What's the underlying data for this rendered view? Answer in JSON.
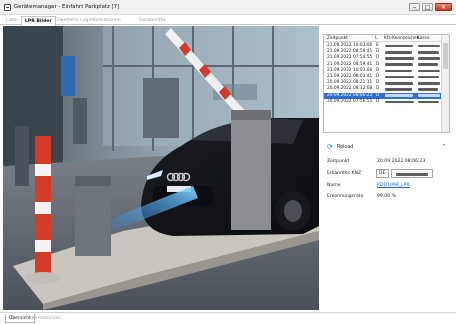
{
  "window": {
    "title": "Gerätemanager - Einfahrt Parkplatz [7]",
    "controls": {
      "minimize": "–",
      "maximize": "□",
      "close": "✕"
    }
  },
  "tabs": [
    {
      "label": "Liste",
      "active": false
    },
    {
      "label": "LPR Bilder",
      "active": true
    },
    {
      "label": "Erweiterte Loginformationen",
      "active": false
    },
    {
      "label": "Geräteinfos",
      "active": false
    }
  ],
  "photo": {
    "description_icon": "camera-image"
  },
  "list": {
    "columns": [
      "Zeitpunkt",
      "L",
      "Kfz-Kennzeichen",
      "Kasse"
    ],
    "rows": [
      {
        "time": "21.09.2022 10:03:00",
        "dir": "E",
        "selected": false
      },
      {
        "time": "21.09.2022 08:59:41",
        "dir": "D",
        "selected": false
      },
      {
        "time": "21.09.2022 07:54:55",
        "dir": "D",
        "selected": false
      },
      {
        "time": "21.09.2022 08:59:41",
        "dir": "D",
        "selected": false
      },
      {
        "time": "21.09.2022 10:03:00",
        "dir": "D",
        "selected": false
      },
      {
        "time": "21.09.2022 08:03:41",
        "dir": "D",
        "selected": false
      },
      {
        "time": "20.09.2022 08:21:11",
        "dir": "D",
        "selected": false
      },
      {
        "time": "20.09.2022 08:12:08",
        "dir": "D",
        "selected": false
      },
      {
        "time": "20.09.2022 08:06:23",
        "dir": "D",
        "selected": true
      },
      {
        "time": "20.09.2022 07:56:55",
        "dir": "D",
        "selected": false
      }
    ]
  },
  "details": {
    "reload_label": "Reload",
    "collapse_glyph": "^",
    "time_label": "Zeitpunkt",
    "time_value": "20.09.2022 08:06:23",
    "plate_label": "Erkanntes KNZ",
    "plate_country": "DE",
    "name_label": "Name",
    "name_value": "KDD1098_LPR",
    "rate_label": "Erkennungsrate",
    "rate_value": "99,00 %"
  },
  "bottom_tabs": [
    {
      "label": "Übersicht",
      "active": true
    },
    {
      "label": "Kennzeichen",
      "active": false
    }
  ],
  "colors": {
    "selection": "#2f6fd6",
    "link": "#1a5fc2",
    "close_button": "#c43b24"
  }
}
